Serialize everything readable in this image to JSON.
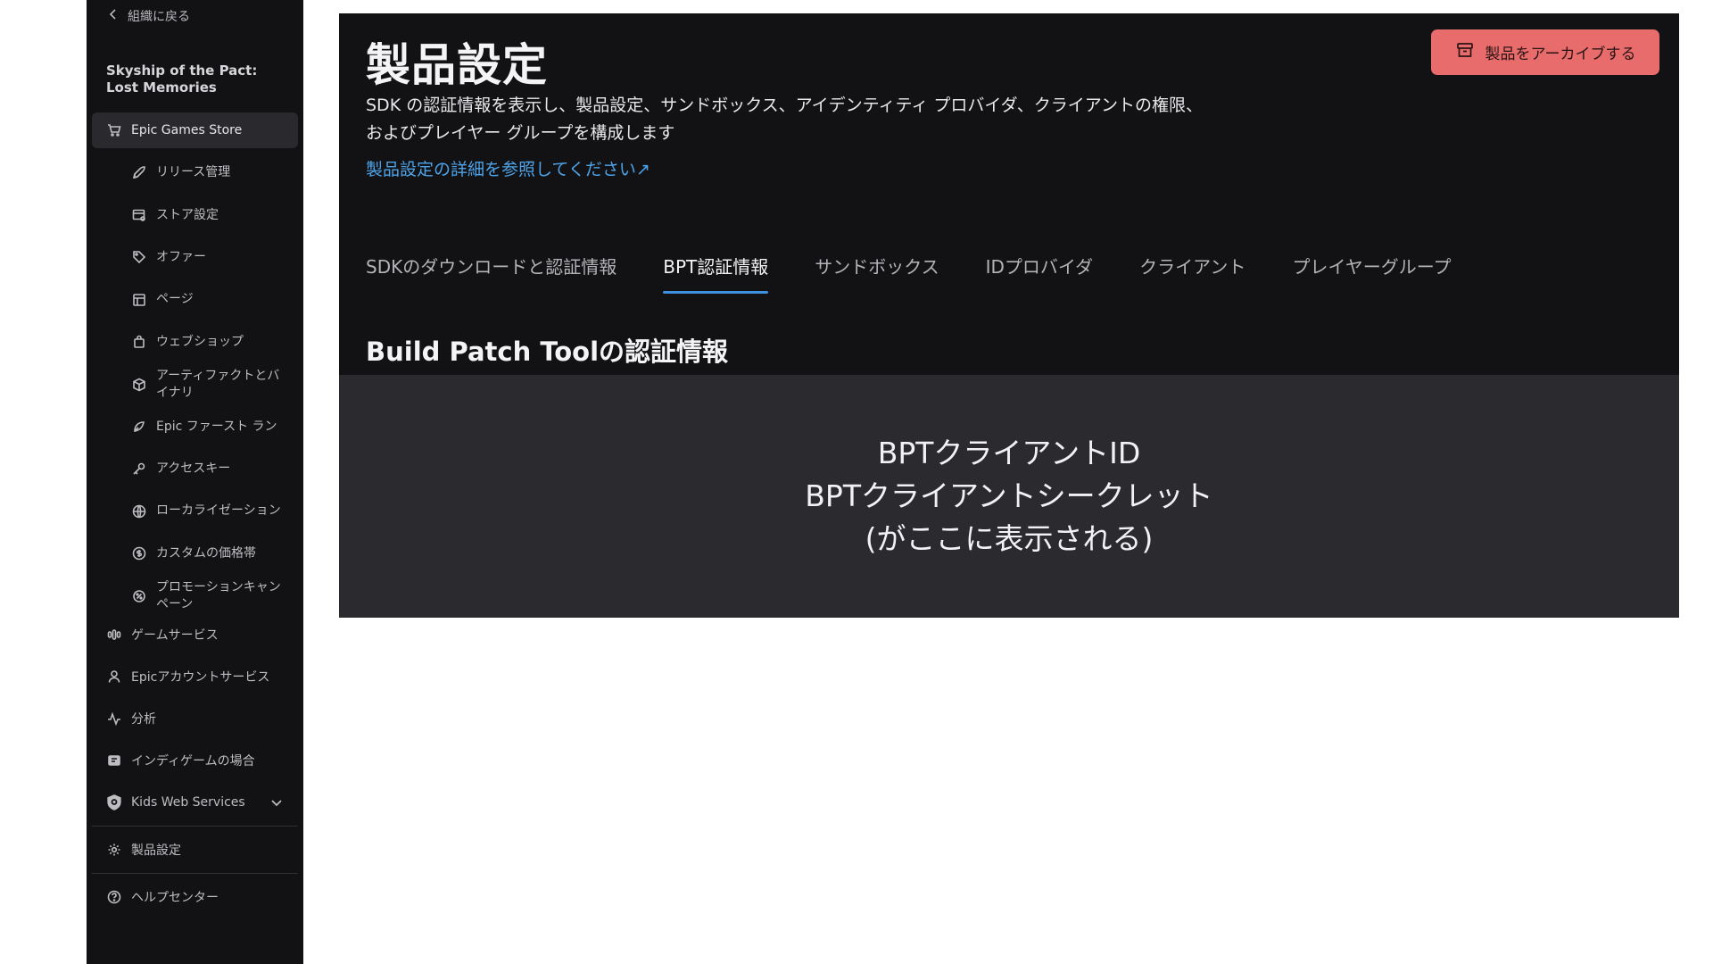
{
  "sidebar": {
    "back_label": "組織に戻る",
    "org_name": "Skyship of the Pact: Lost Memories",
    "store_label": "Epic Games Store",
    "store_items": [
      {
        "label": "リリース管理",
        "icon": "rocket-icon"
      },
      {
        "label": "ストア設定",
        "icon": "store-settings-icon"
      },
      {
        "label": "オファー",
        "icon": "tag-icon"
      },
      {
        "label": "ページ",
        "icon": "layout-icon"
      },
      {
        "label": "ウェブショップ",
        "icon": "shopping-bag-icon"
      },
      {
        "label": "アーティファクトとバイナリ",
        "icon": "box-icon"
      },
      {
        "label": "Epic ファースト ラン",
        "icon": "first-run-icon"
      },
      {
        "label": "アクセスキー",
        "icon": "key-icon"
      },
      {
        "label": "ローカライゼーション",
        "icon": "globe-icon"
      },
      {
        "label": "カスタムの価格帯",
        "icon": "dollar-icon"
      },
      {
        "label": "プロモーションキャンペーン",
        "icon": "badge-icon"
      }
    ],
    "game_services": "ゲームサービス",
    "account_services": "Epicアカウントサービス",
    "analytics": "分析",
    "indie": "インディゲームの場合",
    "kws": "Kids Web Services",
    "product_settings": "製品設定",
    "help_center": "ヘルプセンター"
  },
  "header": {
    "title": "製品設定",
    "description": "SDK の認証情報を表示し、製品設定、サンドボックス、アイデンティティ プロバイダ、クライアントの権限、およびプレイヤー グループを構成します",
    "learn_more": "製品設定の詳細を参照してください↗",
    "archive_button": "製品をアーカイブする"
  },
  "tabs": [
    {
      "label": "SDKのダウンロードと認証情報",
      "active": false
    },
    {
      "label": "BPT認証情報",
      "active": true
    },
    {
      "label": "サンドボックス",
      "active": false
    },
    {
      "label": "IDプロバイダ",
      "active": false
    },
    {
      "label": "クライアント",
      "active": false
    },
    {
      "label": "プレイヤーグループ",
      "active": false
    }
  ],
  "section": {
    "title": "Build Patch Toolの認証情報",
    "line1": "BPTクライアントID",
    "line2": "BPTクライアントシークレット",
    "line3": "(がここに表示される)"
  },
  "colors": {
    "sidebar_bg": "#121214",
    "panel_bg": "#121214",
    "credential_bg": "#2b2b2f",
    "archive_button": "#e86c6b",
    "link": "#4ea3e8",
    "tab_underline": "#3d8fe0"
  }
}
